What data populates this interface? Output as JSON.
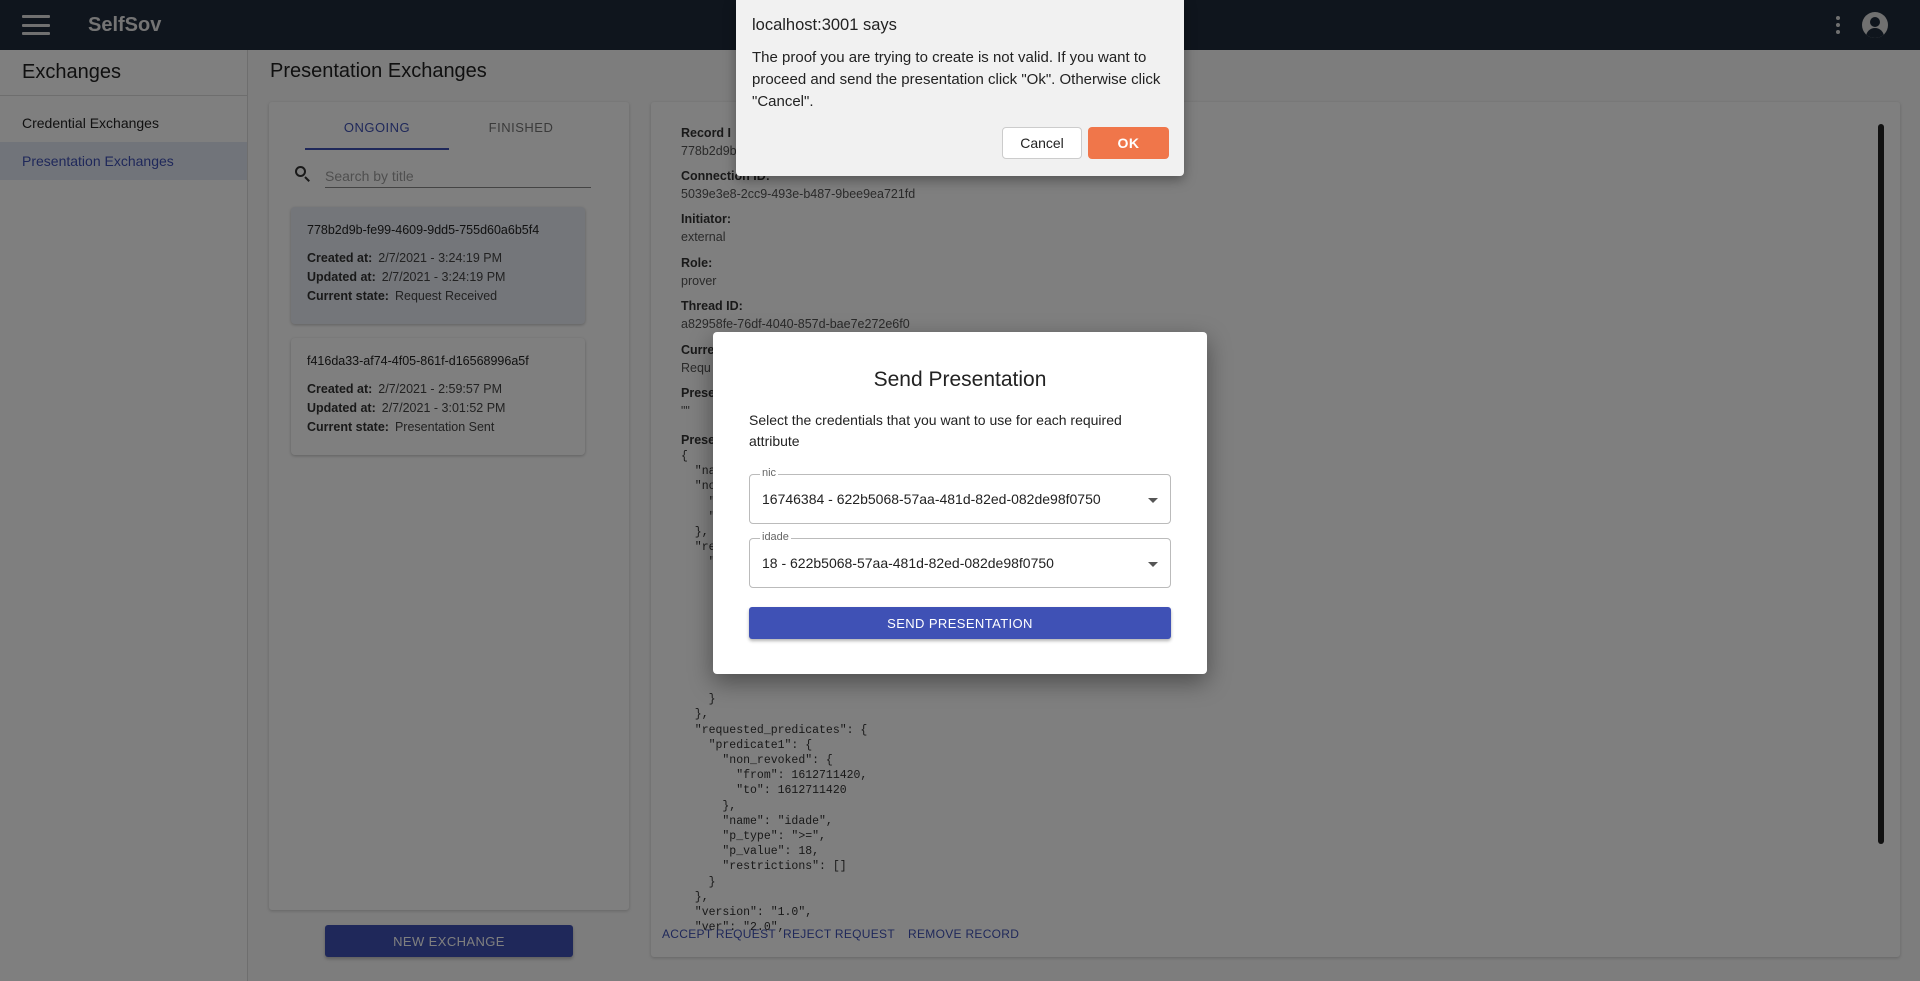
{
  "appbar": {
    "title": "SelfSov"
  },
  "sidebar": {
    "title": "Exchanges",
    "items": [
      {
        "label": "Credential Exchanges"
      },
      {
        "label": "Presentation Exchanges"
      }
    ]
  },
  "main": {
    "title": "Presentation Exchanges",
    "tabs": [
      {
        "label": "ONGOING"
      },
      {
        "label": "FINISHED"
      }
    ],
    "search": {
      "placeholder": "Search by title"
    },
    "cards": [
      {
        "id": "778b2d9b-fe99-4609-9dd5-755d60a6b5f4",
        "created_label": "Created at:",
        "created": "2/7/2021 - 3:24:19 PM",
        "updated_label": "Updated at:",
        "updated": "2/7/2021 - 3:24:19 PM",
        "state_label": "Current state:",
        "state": "Request Received"
      },
      {
        "id": "f416da33-af74-4f05-861f-d16568996a5f",
        "created_label": "Created at:",
        "created": "2/7/2021 - 2:59:57 PM",
        "updated_label": "Updated at:",
        "updated": "2/7/2021 - 3:01:52 PM",
        "state_label": "Current state:",
        "state": "Presentation Sent"
      }
    ],
    "new_exchange": "NEW EXCHANGE"
  },
  "detail": {
    "record_label": "Record I",
    "record_value": "778b2d9b",
    "connection_label": "Connection ID:",
    "connection_value": "5039e3e8-2cc9-493e-b487-9bee9ea721fd",
    "initiator_label": "Initiator:",
    "initiator_value": "external",
    "role_label": "Role:",
    "role_value": "prover",
    "thread_label": "Thread ID:",
    "thread_value": "a82958fe-76df-4040-857d-bae7e272e6f0",
    "state_label": "Curre",
    "state_value": "Requ",
    "pres_label": "Prese",
    "pres_value": "\"\"",
    "pres2_label": "Prese",
    "json_text": "{\n  \"na\n  \"no\n    \"\n    \"\n  },\n  \"re\n    \"\n\n\n\n\n\n\n\n\n    }\n  },\n  \"requested_predicates\": {\n    \"predicate1\": {\n      \"non_revoked\": {\n        \"from\": 1612711420,\n        \"to\": 1612711420\n      },\n      \"name\": \"idade\",\n      \"p_type\": \">=\",\n      \"p_value\": 18,\n      \"restrictions\": []\n    }\n  },\n  \"version\": \"1.0\",\n  \"ver\": \"2.0\",",
    "actions": {
      "accept": "ACCEPT REQUEST",
      "reject": "REJECT REQUEST",
      "remove": "REMOVE RECORD"
    }
  },
  "modal": {
    "title": "Send Presentation",
    "text": "Select the credentials that you want to use for each required attribute",
    "selects": [
      {
        "label": "nic",
        "value": "16746384 - 622b5068-57aa-481d-82ed-082de98f0750"
      },
      {
        "label": "idade",
        "value": "18 - 622b5068-57aa-481d-82ed-082de98f0750"
      }
    ],
    "send": "SEND PRESENTATION"
  },
  "alert": {
    "title": "localhost:3001 says",
    "message": "The proof you are trying to create is not valid. If you want to proceed and send the presentation click \"Ok\". Otherwise click \"Cancel\".",
    "cancel": "Cancel",
    "ok": "OK"
  }
}
